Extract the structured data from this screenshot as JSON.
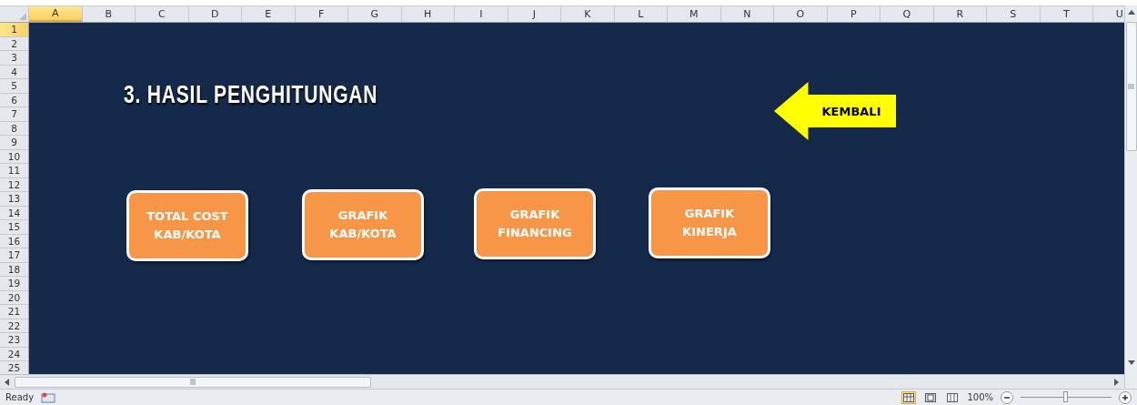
{
  "sheet": {
    "columns": [
      {
        "label": "A",
        "selected": true
      },
      {
        "label": "B",
        "selected": false
      },
      {
        "label": "C",
        "selected": false
      },
      {
        "label": "D",
        "selected": false
      },
      {
        "label": "E",
        "selected": false
      },
      {
        "label": "F",
        "selected": false
      },
      {
        "label": "G",
        "selected": false
      },
      {
        "label": "H",
        "selected": false
      },
      {
        "label": "I",
        "selected": false
      },
      {
        "label": "J",
        "selected": false
      },
      {
        "label": "K",
        "selected": false
      },
      {
        "label": "L",
        "selected": false
      },
      {
        "label": "M",
        "selected": false
      },
      {
        "label": "N",
        "selected": false
      },
      {
        "label": "O",
        "selected": false
      },
      {
        "label": "P",
        "selected": false
      },
      {
        "label": "Q",
        "selected": false
      },
      {
        "label": "R",
        "selected": false
      },
      {
        "label": "S",
        "selected": false
      },
      {
        "label": "T",
        "selected": false
      },
      {
        "label": "U",
        "selected": false
      }
    ],
    "rows": [
      {
        "label": "1",
        "selected": true
      },
      {
        "label": "2",
        "selected": false
      },
      {
        "label": "3",
        "selected": false
      },
      {
        "label": "4",
        "selected": false
      },
      {
        "label": "5",
        "selected": false
      },
      {
        "label": "6",
        "selected": false
      },
      {
        "label": "7",
        "selected": false
      },
      {
        "label": "8",
        "selected": false
      },
      {
        "label": "9",
        "selected": false
      },
      {
        "label": "10",
        "selected": false
      },
      {
        "label": "11",
        "selected": false
      },
      {
        "label": "12",
        "selected": false
      },
      {
        "label": "13",
        "selected": false
      },
      {
        "label": "14",
        "selected": false
      },
      {
        "label": "15",
        "selected": false
      },
      {
        "label": "16",
        "selected": false
      },
      {
        "label": "17",
        "selected": false
      },
      {
        "label": "18",
        "selected": false
      },
      {
        "label": "19",
        "selected": false
      },
      {
        "label": "20",
        "selected": false
      },
      {
        "label": "21",
        "selected": false
      },
      {
        "label": "22",
        "selected": false
      },
      {
        "label": "23",
        "selected": false
      },
      {
        "label": "24",
        "selected": false
      },
      {
        "label": "25",
        "selected": false
      }
    ]
  },
  "title": "3. HASIL PENGHITUNGAN",
  "back_button": {
    "label": "KEMBALI"
  },
  "buttons": [
    {
      "lines": [
        "TOTAL COST",
        "KAB/KOTA"
      ]
    },
    {
      "lines": [
        "GRAFIK",
        "KAB/KOTA"
      ]
    },
    {
      "lines": [
        "GRAFIK",
        "FINANCING"
      ]
    },
    {
      "lines": [
        "GRAFIK",
        "KINERJA"
      ]
    }
  ],
  "status_bar": {
    "status": "Ready",
    "views": [
      {
        "kind": "normal",
        "selected": true
      },
      {
        "kind": "layout",
        "selected": false
      },
      {
        "kind": "pagebreak",
        "selected": false
      }
    ],
    "zoom": "100%",
    "zoom_slider": {
      "level": 0.5
    }
  }
}
